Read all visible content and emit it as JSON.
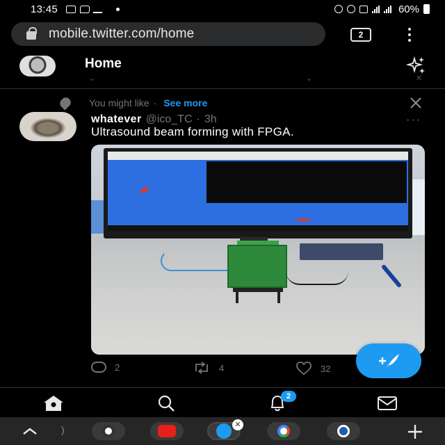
{
  "status_bar": {
    "time": "13:45",
    "battery": "60%"
  },
  "browser": {
    "url": "mobile.twitter.com/home",
    "tab_count": "2"
  },
  "header": {
    "title": "Home"
  },
  "suggestion": {
    "label": "You might like",
    "separator": "·",
    "see_more": "See more"
  },
  "tweet": {
    "name": "whatever",
    "handle": "@ico_TC",
    "dot": "·",
    "time": "3h",
    "more": "···",
    "text": "Ultrasound beam forming with FPGA.",
    "replies": "2",
    "retweets": "4",
    "likes": "32"
  },
  "bottom_nav": {
    "notification_count": "2"
  },
  "colors": {
    "accent": "#1d9bf0",
    "background": "#000000",
    "muted": "#71767b"
  }
}
